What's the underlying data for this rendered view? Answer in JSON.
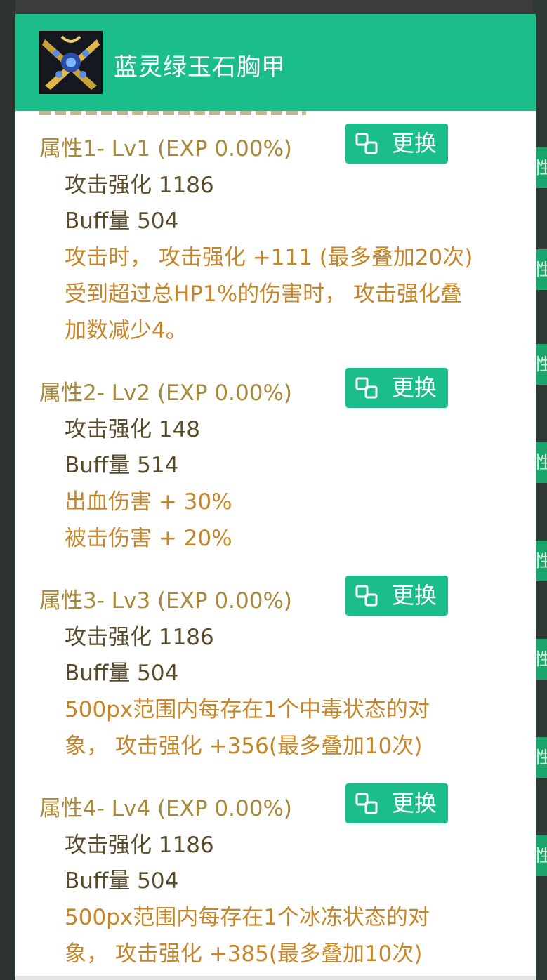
{
  "dialog": {
    "title": "蓝灵绿玉石胸甲",
    "swap_label": "更换"
  },
  "properties": [
    {
      "heading": "属性1- Lv1 (EXP 0.00%)",
      "stats": [
        "攻击强化 1186",
        "Buff量 504"
      ],
      "effects": [
        "攻击时， 攻击强化 +111 (最多叠加20次)",
        "受到超过总HP1%的伤害时， 攻击强化叠",
        "加数减少4。"
      ]
    },
    {
      "heading": "属性2- Lv2 (EXP 0.00%)",
      "stats": [
        "攻击强化 148",
        "Buff量 514"
      ],
      "effects": [
        "出血伤害 + 30%",
        "被击伤害 + 20%"
      ]
    },
    {
      "heading": "属性3- Lv3 (EXP 0.00%)",
      "stats": [
        "攻击强化 1186",
        "Buff量 504"
      ],
      "effects": [
        "500px范围内每存在1个中毒状态的对",
        "象， 攻击强化 +356(最多叠加10次)"
      ]
    },
    {
      "heading": "属性4- Lv4 (EXP 0.00%)",
      "stats": [
        "攻击强化 1186",
        "Buff量 504"
      ],
      "effects": [
        "500px范围内每存在1个冰冻状态的对",
        "象， 攻击强化 +385(最多叠加10次)"
      ]
    }
  ],
  "background": {
    "tab_char": "性"
  },
  "colors": {
    "accent": "#1bbd8b",
    "heading": "#a8893a",
    "stat": "#5a4c2a",
    "effect": "#c4862b"
  }
}
